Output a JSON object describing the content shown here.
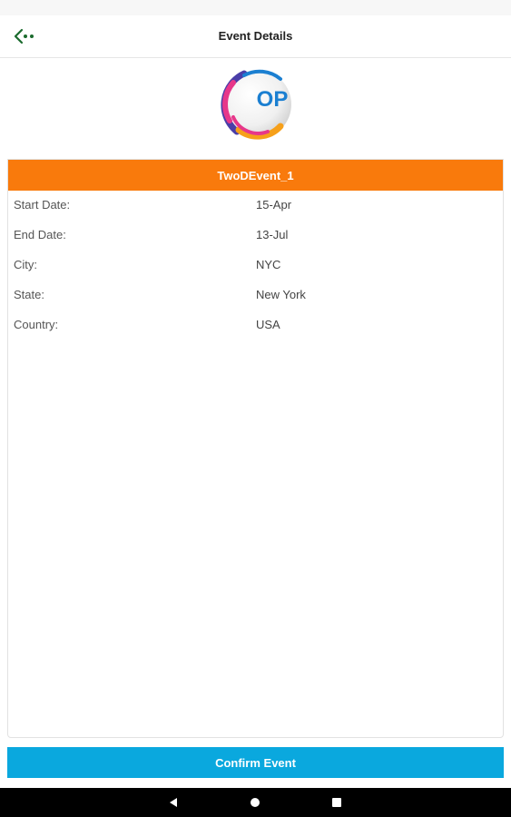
{
  "status_bar": {
    "left_text": "",
    "right_text": ""
  },
  "app_bar": {
    "title": "Event Details",
    "back_icon": "back-arrow-icon"
  },
  "logo": {
    "text": "OP",
    "colors": [
      "#e7378a",
      "#f6a01a",
      "#4a3ea8",
      "#1b7fd1"
    ]
  },
  "event": {
    "name": "TwoDEvent_1",
    "details": [
      {
        "label": "Start Date:",
        "value": "15-Apr"
      },
      {
        "label": "End Date:",
        "value": "13-Jul"
      },
      {
        "label": "City:",
        "value": "NYC"
      },
      {
        "label": "State:",
        "value": "New York"
      },
      {
        "label": "Country:",
        "value": "USA"
      }
    ]
  },
  "actions": {
    "confirm_label": "Confirm Event"
  },
  "colors": {
    "header_orange": "#f97a0c",
    "confirm_blue": "#0aa8de",
    "back_icon_green": "#1b6b2e"
  },
  "system_nav": {
    "back": "nav-back-icon",
    "home": "nav-home-icon",
    "recents": "nav-recents-icon"
  }
}
